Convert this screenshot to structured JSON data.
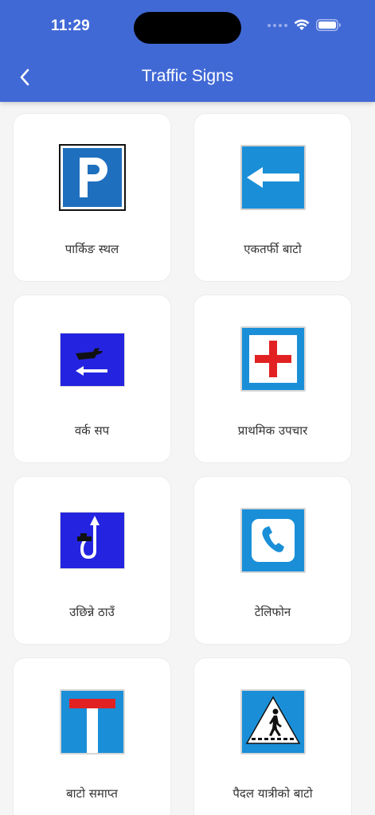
{
  "status_bar": {
    "time": "11:29"
  },
  "header": {
    "title": "Traffic Signs",
    "back_icon": "chevron-left-icon",
    "background": "#4169d6"
  },
  "signs": [
    {
      "label": "पार्किङ स्थल",
      "icon": "parking-sign-icon"
    },
    {
      "label": "एकतर्फी बाटो",
      "icon": "one-way-arrow-sign-icon"
    },
    {
      "label": "वर्क सप",
      "icon": "workshop-wrench-sign-icon"
    },
    {
      "label": "प्राथमिक उपचार",
      "icon": "first-aid-cross-sign-icon"
    },
    {
      "label": "उछिन्ने ठाउँ",
      "icon": "u-turn-place-sign-icon"
    },
    {
      "label": "टेलिफोन",
      "icon": "telephone-sign-icon"
    },
    {
      "label": "बाटो समाप्त",
      "icon": "dead-end-sign-icon"
    },
    {
      "label": "पैदल यात्रीको बाटो",
      "icon": "pedestrian-crossing-sign-icon"
    }
  ]
}
